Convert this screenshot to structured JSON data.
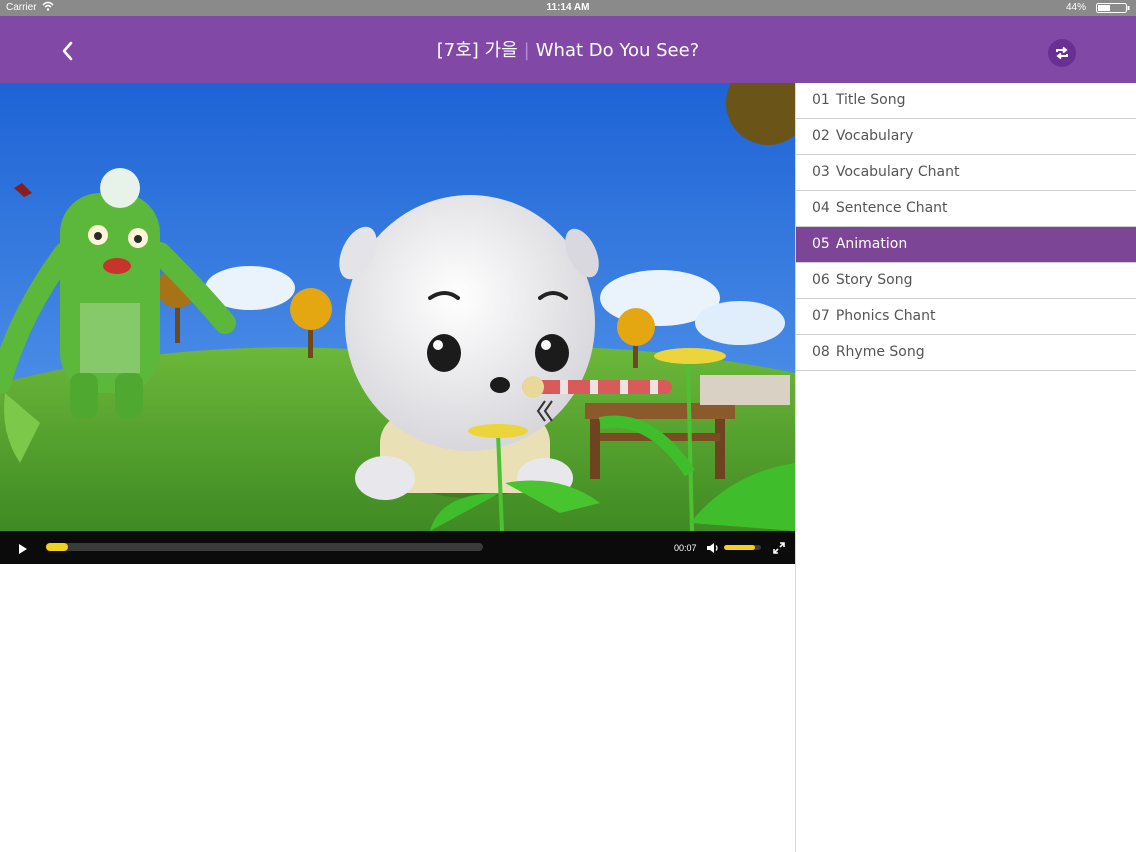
{
  "status_bar": {
    "carrier": "Carrier",
    "time": "11:14 AM",
    "battery": "44%"
  },
  "header": {
    "title_part1": "[7호] 가을",
    "separator": "|",
    "title_part2": "What Do You See?",
    "back_icon": "chevron-left-icon",
    "refresh_icon": "refresh-icon",
    "color": "#8149a5"
  },
  "player": {
    "current_time": "00:07",
    "progress": 0.05,
    "volume": 0.85,
    "accent_color": "#f2d21b"
  },
  "playlist": {
    "items": [
      {
        "num": "01",
        "label": "Title Song",
        "active": false
      },
      {
        "num": "02",
        "label": "Vocabulary",
        "active": false
      },
      {
        "num": "03",
        "label": "Vocabulary Chant",
        "active": false
      },
      {
        "num": "04",
        "label": "Sentence Chant",
        "active": false
      },
      {
        "num": "05",
        "label": "Animation",
        "active": true
      },
      {
        "num": "06",
        "label": "Story Song",
        "active": false
      },
      {
        "num": "07",
        "label": "Phonics Chant",
        "active": false
      },
      {
        "num": "08",
        "label": "Rhyme Song",
        "active": false
      }
    ],
    "active_color": "#7c4595"
  }
}
